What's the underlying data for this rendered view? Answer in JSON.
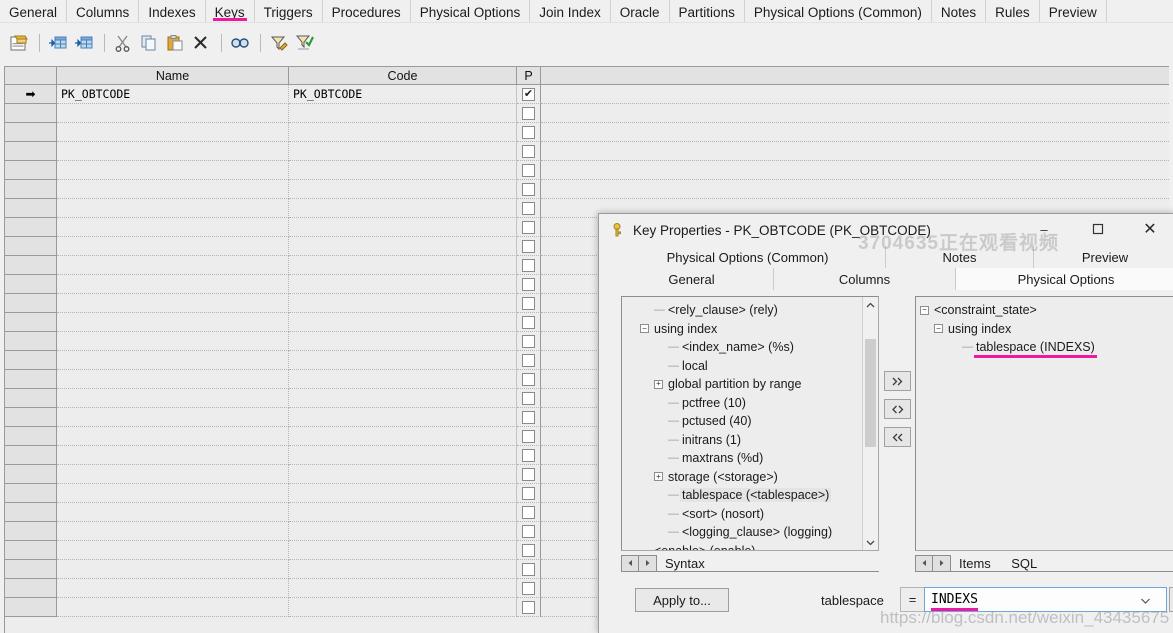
{
  "main_tabs": [
    {
      "label": "General",
      "active": false
    },
    {
      "label": "Columns",
      "active": false
    },
    {
      "label": "Indexes",
      "active": false
    },
    {
      "label": "Keys",
      "active": true
    },
    {
      "label": "Triggers",
      "active": false
    },
    {
      "label": "Procedures",
      "active": false
    },
    {
      "label": "Physical Options",
      "active": false
    },
    {
      "label": "Join Index",
      "active": false
    },
    {
      "label": "Oracle",
      "active": false
    },
    {
      "label": "Partitions",
      "active": false
    },
    {
      "label": "Physical Options (Common)",
      "active": false
    },
    {
      "label": "Notes",
      "active": false
    },
    {
      "label": "Rules",
      "active": false
    },
    {
      "label": "Preview",
      "active": false
    }
  ],
  "toolbar": {
    "buttons": [
      {
        "name": "properties-icon",
        "tip": "Properties"
      },
      {
        "name": "insert-row-icon",
        "tip": "Insert a Row"
      },
      {
        "name": "add-row-icon",
        "tip": "Add a Row"
      },
      {
        "name": "cut-icon",
        "tip": "Cut"
      },
      {
        "name": "copy-icon",
        "tip": "Copy"
      },
      {
        "name": "paste-icon",
        "tip": "Paste"
      },
      {
        "name": "delete-icon",
        "tip": "Delete"
      },
      {
        "name": "find-icon",
        "tip": "Find"
      },
      {
        "name": "customize-filter-icon",
        "tip": "Customize Columns and Filter"
      },
      {
        "name": "apply-filter-icon",
        "tip": "Apply Filter"
      }
    ]
  },
  "grid": {
    "columns": [
      "",
      "Name",
      "Code",
      "P"
    ],
    "header_name": "Name",
    "header_code": "Code",
    "header_p": "P",
    "rows": [
      {
        "marker": "➡",
        "name": "PK_OBTCODE",
        "code": "PK_OBTCODE",
        "p": true,
        "selected": true
      }
    ],
    "empty_row_count": 27,
    "row_marker": "➡"
  },
  "dialog": {
    "title": "Key Properties - PK_OBTCODE (PK_OBTCODE)",
    "icon": "key-icon",
    "window_controls": {
      "minimize": "–",
      "maximize": "☐",
      "close": "✕"
    },
    "tabs_row1": [
      {
        "label": "Physical Options (Common)",
        "active": false
      },
      {
        "label": "Notes",
        "active": false
      },
      {
        "label": "Preview",
        "active": false
      }
    ],
    "tabs_row2": [
      {
        "label": "General",
        "active": false
      },
      {
        "label": "Columns",
        "active": false
      },
      {
        "label": "Physical Options",
        "active": true
      }
    ],
    "syntax_tree": [
      {
        "label": "<rely_clause> (rely)",
        "indent": 2,
        "box": "",
        "selected": false
      },
      {
        "label": "using index",
        "indent": 1,
        "box": "-",
        "selected": false
      },
      {
        "label": "<index_name> (%s)",
        "indent": 3,
        "box": "",
        "selected": false
      },
      {
        "label": "local",
        "indent": 3,
        "box": "",
        "selected": false
      },
      {
        "label": "global partition by range",
        "indent": 2,
        "box": "+",
        "selected": false
      },
      {
        "label": "pctfree (10)",
        "indent": 3,
        "box": "",
        "selected": false
      },
      {
        "label": "pctused (40)",
        "indent": 3,
        "box": "",
        "selected": false
      },
      {
        "label": "initrans (1)",
        "indent": 3,
        "box": "",
        "selected": false
      },
      {
        "label": "maxtrans (%d)",
        "indent": 3,
        "box": "",
        "selected": false
      },
      {
        "label": "storage (<storage>)",
        "indent": 2,
        "box": "+",
        "selected": false
      },
      {
        "label": "tablespace (<tablespace>)",
        "indent": 3,
        "box": "",
        "selected": true
      },
      {
        "label": "<sort> (nosort)",
        "indent": 3,
        "box": "",
        "selected": false
      },
      {
        "label": "<logging_clause> (logging)",
        "indent": 3,
        "box": "",
        "selected": false
      },
      {
        "label": "<enable> (enable)",
        "indent": 1,
        "box": "",
        "selected": false
      }
    ],
    "items_tree": [
      {
        "label": "<constraint_state>",
        "indent": 0,
        "box": "-",
        "annotated": false
      },
      {
        "label": "using index",
        "indent": 1,
        "box": "-",
        "annotated": false
      },
      {
        "label": "tablespace (INDEXS)",
        "indent": 3,
        "box": "",
        "annotated": true
      }
    ],
    "transfer_buttons": [
      {
        "label": "»",
        "name": "move-right-button"
      },
      {
        "label": "‹›",
        "name": "swap-button"
      },
      {
        "label": "«",
        "name": "move-left-button"
      }
    ],
    "left_sheet_tabs": [
      {
        "label": "Syntax",
        "active": true
      }
    ],
    "right_sheet_tabs": [
      {
        "label": "Items",
        "active": true
      },
      {
        "label": "SQL",
        "active": false
      }
    ],
    "nav_prev": "◀",
    "nav_next": "▶",
    "apply_to_label": "Apply to...",
    "property_label": "tablespace",
    "equals_sign": "=",
    "property_value": "INDEXS",
    "browse_label": "...",
    "dropdown_caret": "⌄"
  },
  "watermarks": {
    "viewer": "3704635正在观看视频",
    "url": "https://blog.csdn.net/weixin_43435675"
  },
  "colors": {
    "accent_magenta": "#f0189f",
    "window_bg": "#f0f0f0",
    "grid_bg": "#ededed",
    "focus_border": "#6aa6e0"
  }
}
